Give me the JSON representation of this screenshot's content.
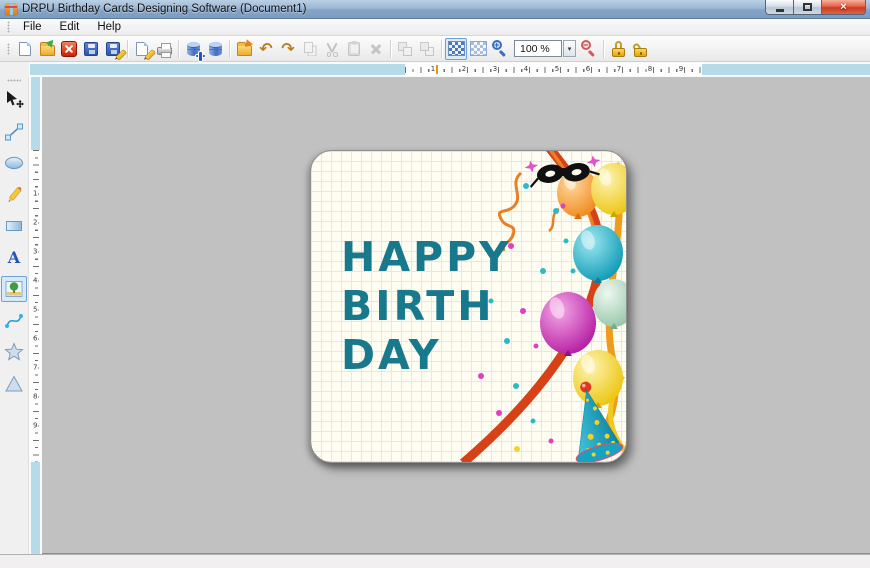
{
  "window": {
    "title": "DRPU Birthday Cards Designing Software  (Document1)",
    "close_glyph": "×"
  },
  "menu": {
    "items": [
      "File",
      "Edit",
      "Help"
    ]
  },
  "toolbar": {
    "zoom_value": "100 %",
    "glyphs": {
      "undo": "↶",
      "redo": "↷",
      "zoom_in_sign": "+",
      "zoom_out_sign": "−",
      "combo_arrow": "▾"
    },
    "buttons": [
      "new-document",
      "open-file",
      "close-file",
      "save",
      "save-as",
      "edit-card",
      "print",
      "add-database",
      "database",
      "export-design",
      "undo",
      "redo",
      "copy",
      "cut",
      "paste",
      "delete",
      "bring-forward",
      "send-backward",
      "dense-grid-pattern",
      "light-grid-pattern",
      "zoom-in",
      "zoom-level-combo",
      "zoom-out",
      "lock",
      "unlock"
    ]
  },
  "tools": {
    "items": [
      "select-move",
      "line",
      "ellipse",
      "pencil",
      "rectangle",
      "text",
      "image",
      "curve",
      "star",
      "triangle"
    ],
    "text_glyph": "A"
  },
  "rulers": {
    "horizontal_numbers": [
      "1",
      "2",
      "3",
      "4",
      "5",
      "6",
      "7",
      "8",
      "9"
    ],
    "vertical_numbers": [
      "1",
      "2",
      "3",
      "4",
      "5",
      "6",
      "7",
      "8",
      "9"
    ]
  },
  "card": {
    "text_lines": [
      "HAPPY",
      "BIRTH",
      "DAY"
    ],
    "text_color": "#17798b",
    "background_color": "#fffdf2",
    "grid_color": "#f2eda2"
  },
  "colors": {
    "titlebar": "#8fadcc",
    "ruler_track": "#b5dbe8",
    "canvas": "#c1c1c1",
    "balloon_orange": "#f08820",
    "balloon_yellow": "#edc414",
    "balloon_teal": "#129db8",
    "balloon_magenta": "#b81fa4",
    "balloon_green": "#9cc9ab",
    "hat_teal": "#15a0c0",
    "ribbon_red": "#d64118",
    "ribbon_orange": "#ef9c1e"
  }
}
